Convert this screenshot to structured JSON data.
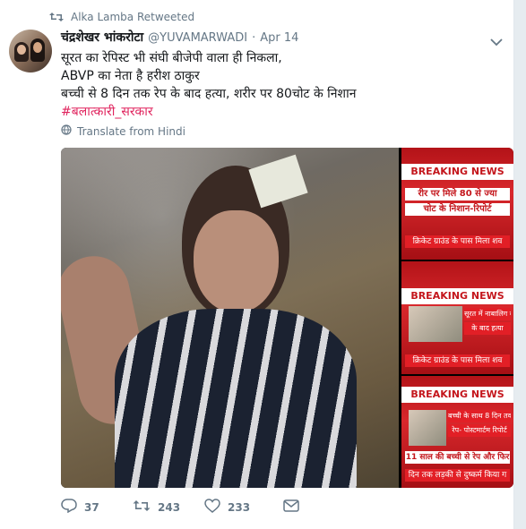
{
  "retweet_header": {
    "icon": "retweet-icon",
    "text": "Alka Lamba Retweeted"
  },
  "author": {
    "name": "चंद्रशेखर भांकरोटा",
    "handle": "@YUVAMARWADI",
    "separator": "·",
    "date": "Apr 14"
  },
  "tweet": {
    "lines": [
      "सूरत का रेपिस्ट भी संघी बीजेपी वाला ही निकला,",
      "ABVP का नेता है हरीश ठाकुर",
      "बच्ची से 8 दिन तक रेप के बाद हत्या, शरीर पर 80चोट के निशान"
    ],
    "hashtag": "#बलात्कारी_सरकार"
  },
  "translate": {
    "icon": "globe-icon",
    "label": "Translate from Hindi"
  },
  "media": {
    "thumb1": {
      "banner": "BREAKING NEWS",
      "line1": "रीर पर मिले 80 से ज्या",
      "line2": "चोट के निशान-रिपोर्ट",
      "ticker": "क्रिकेट ग्राउंड के पास मिला शव"
    },
    "thumb2": {
      "banner": "BREAKING NEWS",
      "line1": "सूरत में नाबालिग की रे",
      "line2": "के बाद हत्या",
      "ticker": "क्रिकेट ग्राउंड के पास मिला शव"
    },
    "thumb3": {
      "banner": "BREAKING NEWS",
      "line1": "बच्ची के साथ 8 दिन तक",
      "line2": "रेप- पोस्टमार्टम रिपोर्ट",
      "line3": "11 साल की बच्ची से रेप और फिर",
      "ticker": "दिन तक लड़की से दुष्कर्म किया ग"
    }
  },
  "actions": {
    "reply_count": "37",
    "retweet_count": "243",
    "like_count": "233"
  },
  "colors": {
    "hashtag": "#e0245e",
    "muted": "#657786",
    "text": "#14171a",
    "breaking_red": "#c4161c"
  }
}
